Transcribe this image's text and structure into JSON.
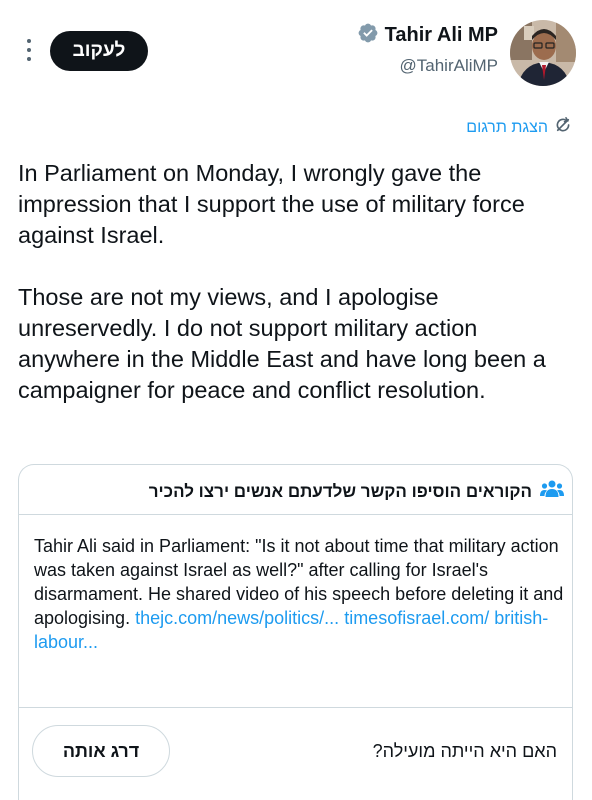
{
  "header": {
    "follow_label": "לעקוב",
    "author_name": "Tahir Ali MP",
    "handle": "@TahirAliMP"
  },
  "translation": {
    "label": "הצגת תרגום"
  },
  "tweet": {
    "paragraphs": [
      "In Parliament on Monday, I wrongly gave the impression that I support the use of military force against Israel.",
      "Those are not my views, and I apologise unreservedly. I do not support military action anywhere in the Middle East and have long been a campaigner for peace and conflict resolution."
    ]
  },
  "community_note": {
    "heading": "הקוראים הוסיפו הקשר שלדעתם אנשים ירצו להכיר",
    "body": "Tahir Ali said in Parliament: \"Is it not about time that military action was taken against Israel as well?\" after calling for Israel's disarmament. He shared video of his speech before deleting it and apologising.",
    "links": [
      "thejc.com/news/politics/...",
      "timesofisrael.com/ british-labour..."
    ],
    "question": "האם היא הייתה מועילה?",
    "rate_label": "דרג אותה"
  },
  "colors": {
    "accent": "#1d9bf0",
    "text": "#0f1419",
    "muted": "#536471",
    "border": "#cfd9de"
  }
}
